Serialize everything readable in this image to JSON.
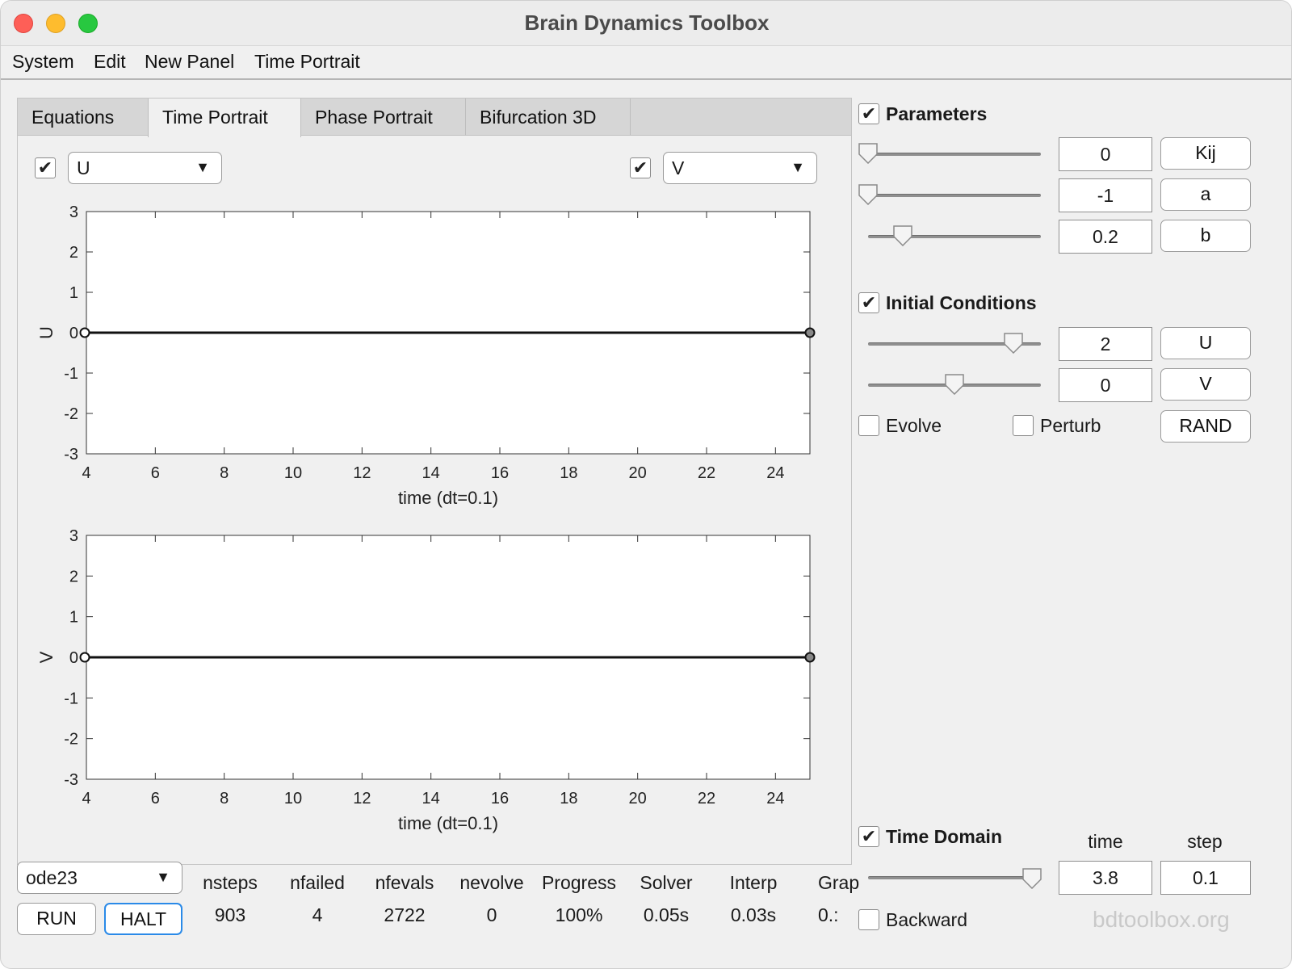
{
  "window": {
    "title": "Brain Dynamics Toolbox"
  },
  "menu": {
    "items": [
      "System",
      "Edit",
      "New Panel",
      "Time Portrait"
    ]
  },
  "tabs": [
    {
      "label": "Equations",
      "active": false
    },
    {
      "label": "Time Portrait",
      "active": true
    },
    {
      "label": "Phase Portrait",
      "active": false
    },
    {
      "label": "Bifurcation 3D",
      "active": false
    }
  ],
  "time_portrait": {
    "left_select": {
      "checked": true,
      "value": "U"
    },
    "right_select": {
      "checked": true,
      "value": "V"
    }
  },
  "chart_data": [
    {
      "type": "line",
      "ylabel": "U",
      "xlabel": "time (dt=0.1)",
      "xlim": [
        4,
        25
      ],
      "ylim": [
        -3,
        3
      ],
      "xticks": [
        4,
        6,
        8,
        10,
        12,
        14,
        16,
        18,
        20,
        22,
        24
      ],
      "yticks": [
        3,
        2,
        1,
        0,
        -1,
        -2,
        -3
      ],
      "series": [
        {
          "x": [
            3.8,
            25
          ],
          "y": [
            0,
            0
          ],
          "start_marker": "open",
          "end_marker": "filled"
        }
      ],
      "line_color": "#111111"
    },
    {
      "type": "line",
      "ylabel": "V",
      "xlabel": "time (dt=0.1)",
      "xlim": [
        4,
        25
      ],
      "ylim": [
        -3,
        3
      ],
      "xticks": [
        4,
        6,
        8,
        10,
        12,
        14,
        16,
        18,
        20,
        22,
        24
      ],
      "yticks": [
        3,
        2,
        1,
        0,
        -1,
        -2,
        -3
      ],
      "series": [
        {
          "x": [
            3.8,
            25
          ],
          "y": [
            0,
            0
          ],
          "start_marker": "open",
          "end_marker": "filled"
        }
      ],
      "line_color": "#111111"
    }
  ],
  "solver": {
    "method": "ode23",
    "run_label": "RUN",
    "halt_label": "HALT",
    "stats": [
      {
        "header": "nsteps",
        "value": "903"
      },
      {
        "header": "nfailed",
        "value": "4"
      },
      {
        "header": "nfevals",
        "value": "2722"
      },
      {
        "header": "nevolve",
        "value": "0"
      },
      {
        "header": "Progress",
        "value": "100%"
      },
      {
        "header": "Solver",
        "value": "0.05s"
      },
      {
        "header": "Interp",
        "value": "0.03s"
      },
      {
        "header": "Grap",
        "value": "0.:"
      }
    ]
  },
  "parameters": {
    "title": "Parameters",
    "checked": true,
    "rows": [
      {
        "value": "0",
        "label": "Kij",
        "slider_fraction": 0.0
      },
      {
        "value": "-1",
        "label": "a",
        "slider_fraction": 0.0
      },
      {
        "value": "0.2",
        "label": "b",
        "slider_fraction": 0.2
      }
    ]
  },
  "initial_conditions": {
    "title": "Initial Conditions",
    "checked": true,
    "rows": [
      {
        "value": "2",
        "label": "U",
        "slider_fraction": 0.84
      },
      {
        "value": "0",
        "label": "V",
        "slider_fraction": 0.5
      }
    ],
    "evolve_label": "Evolve",
    "perturb_label": "Perturb",
    "rand_label": "RAND"
  },
  "time_domain": {
    "title": "Time Domain",
    "checked": true,
    "time_header": "time",
    "step_header": "step",
    "time_value": "3.8",
    "step_value": "0.1",
    "slider_fraction": 0.95,
    "backward_label": "Backward"
  },
  "watermark": "bdtoolbox.org"
}
